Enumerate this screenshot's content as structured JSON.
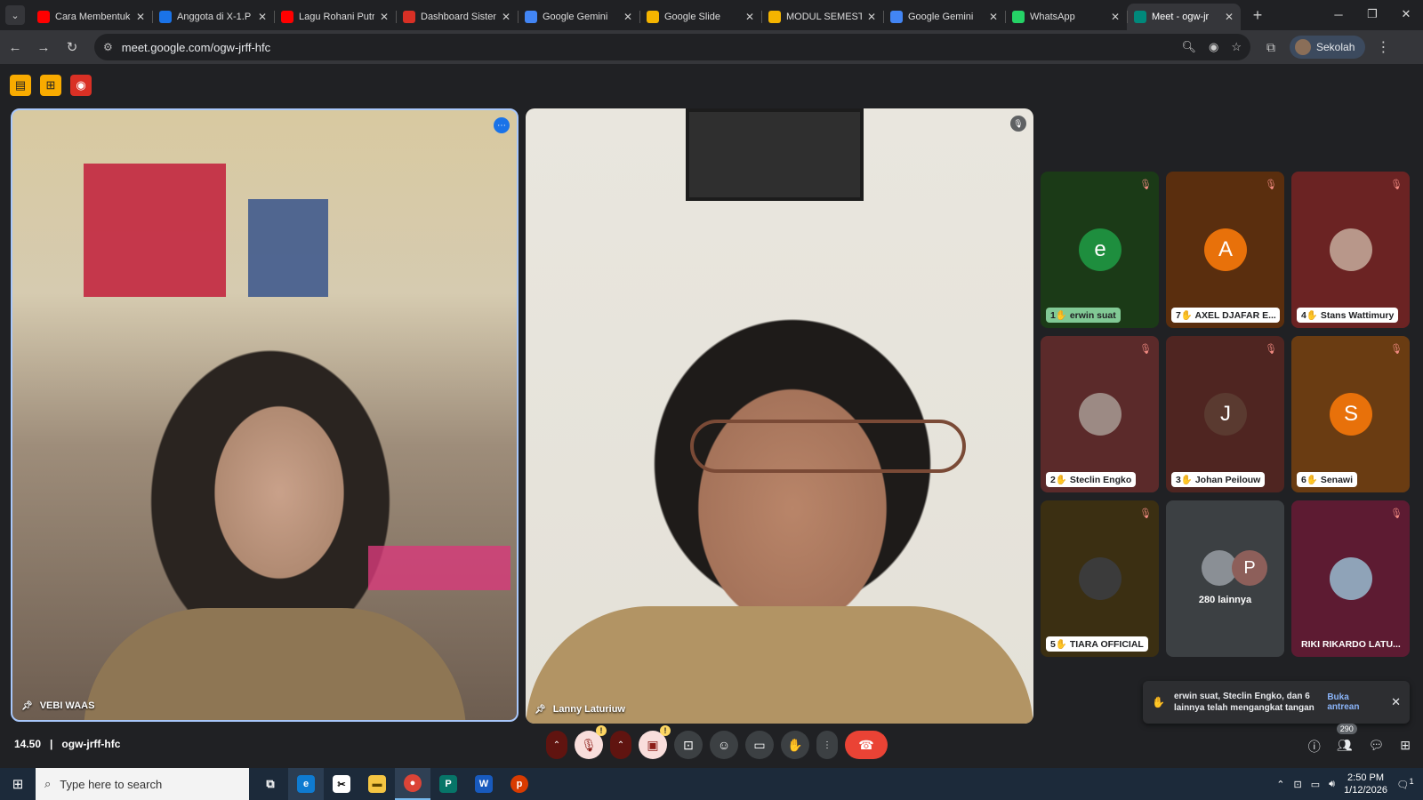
{
  "browser": {
    "tabs": [
      {
        "title": "Cara Membentuk",
        "favicon": "youtube-icon",
        "color": "#ff0000"
      },
      {
        "title": "Anggota di X-1.P",
        "favicon": "doc-icon",
        "color": "#1a73e8"
      },
      {
        "title": "Lagu Rohani Putri",
        "favicon": "youtube-icon",
        "color": "#ff0000"
      },
      {
        "title": "Dashboard Sistem",
        "favicon": "dashboard-icon",
        "color": "#d93025"
      },
      {
        "title": "Google Gemini",
        "favicon": "gemini-icon",
        "color": "#4285f4"
      },
      {
        "title": "Google Slide",
        "favicon": "slides-icon",
        "color": "#f4b400"
      },
      {
        "title": "MODUL SEMESTE",
        "favicon": "slides-icon",
        "color": "#f4b400"
      },
      {
        "title": "Google Gemini",
        "favicon": "gemini-icon",
        "color": "#4285f4"
      },
      {
        "title": "WhatsApp",
        "favicon": "whatsapp-icon",
        "color": "#25d366"
      },
      {
        "title": "Meet - ogw-jr",
        "favicon": "meet-icon",
        "color": "#00897b"
      }
    ],
    "url": "meet.google.com/ogw-jrff-hfc",
    "profile_name": "Sekolah"
  },
  "meet": {
    "main_tiles": [
      {
        "name": "VEBI WAAS"
      },
      {
        "name": "Lanny Laturiuw"
      }
    ],
    "grid": [
      {
        "initial": "e",
        "label": "1✋ erwin suat",
        "avatar_color": "#1e8e3e",
        "bg": "#1b3a17",
        "label_style": "green"
      },
      {
        "initial": "A",
        "label": "7✋ AXEL DJAFAR E...",
        "avatar_color": "#e8710a",
        "bg": "#5a2e0e",
        "label_style": "white"
      },
      {
        "initial": "",
        "label": "4✋ Stans Wattimury",
        "avatar_color": "#b8978a",
        "bg": "#6b2323",
        "label_style": "white"
      },
      {
        "initial": "",
        "label": "2✋ Steclin Engko",
        "avatar_color": "#9c8a84",
        "bg": "#5b2a2a",
        "label_style": "white"
      },
      {
        "initial": "J",
        "label": "3✋ Johan Peilouw",
        "avatar_color": "#5a3a30",
        "bg": "#4f2521",
        "label_style": "white"
      },
      {
        "initial": "S",
        "label": "6✋ Senawi",
        "avatar_color": "#e8710a",
        "bg": "#6a3c12",
        "label_style": "white"
      },
      {
        "initial": "",
        "label": "5✋ TIARA OFFICIAL",
        "avatar_color": "#3b3b3b",
        "bg": "#3b2f12",
        "label_style": "white"
      },
      {
        "more_text": "280 lainnya",
        "more_initial": "P"
      },
      {
        "initial": "",
        "label": "RIKI RIKARDO LATU...",
        "avatar_color": "#8fa3b8",
        "bg": "#5d1b32",
        "label_style": "plain"
      }
    ],
    "toast": {
      "message": "erwin suat, Steclin Engko, dan 6 lainnya telah mengangkat tangan",
      "action": "Buka antrean"
    },
    "time": "14.50",
    "code": "ogw-jrff-hfc",
    "participant_count": "290"
  },
  "taskbar": {
    "search_placeholder": "Type here to search",
    "time": "2:50 PM",
    "date": "1/12/2026",
    "notif_count": "1"
  }
}
